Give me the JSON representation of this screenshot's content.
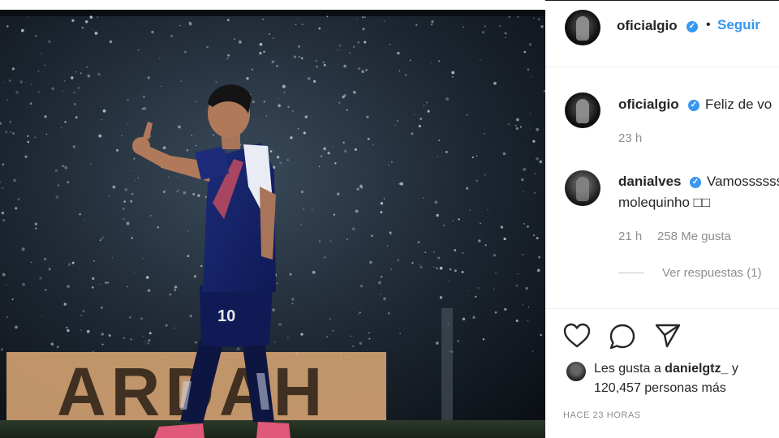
{
  "post": {
    "username": "oficialgio",
    "follow_label": "Seguir",
    "dot": "•"
  },
  "comments": [
    {
      "username": "oficialgio",
      "text": "Feliz de vo",
      "time": "23 h"
    },
    {
      "username": "danialves",
      "text_line1": "Vamossssss",
      "text_line2": "molequinho □□",
      "time": "21 h",
      "likes": "258 Me gusta",
      "replies": "Ver respuestas (1)"
    }
  ],
  "likes": {
    "prefix": "Les gusta a ",
    "user": "danielgtz_",
    "joiner": " y",
    "count_line": "120,457 personas más"
  },
  "posted_time": "HACE 23 HORAS",
  "photo": {
    "banner_text": "ARDAH",
    "shirt_number": "10"
  },
  "colors": {
    "accent": "#3897f0",
    "text": "#262626",
    "muted": "#8e8e8e"
  },
  "icons": [
    "heart-icon",
    "comment-icon",
    "share-icon",
    "verified-badge-icon"
  ]
}
